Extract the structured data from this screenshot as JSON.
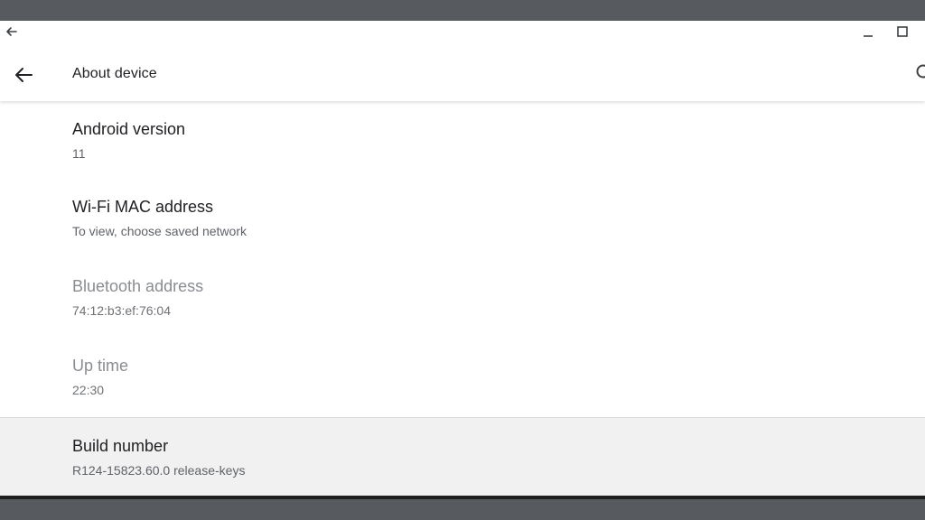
{
  "window": {
    "titlebar": {
      "back_icon": "arrow-left-icon",
      "minimize_icon": "minimize-icon",
      "maximize_icon": "maximize-icon"
    }
  },
  "appbar": {
    "title": "About device",
    "back_icon": "arrow-left-icon",
    "search_icon": "search-icon"
  },
  "items": [
    {
      "title": "Android version",
      "summary": "11"
    },
    {
      "title": "Wi-Fi MAC address",
      "summary": "To view, choose saved network"
    },
    {
      "title": "Bluetooth address",
      "summary": "74:12:b3:ef:76:04"
    },
    {
      "title": "Up time",
      "summary": "22:30"
    },
    {
      "title": "Build number",
      "summary": "R124-15823.60.0 release-keys"
    }
  ],
  "colors": {
    "desktop": "#575b5f",
    "surface": "#ffffff",
    "highlight_row": "#f1f1f1",
    "primary_text": "#202124",
    "secondary_text": "#5f6368",
    "disabled_text": "#8a8d91"
  }
}
